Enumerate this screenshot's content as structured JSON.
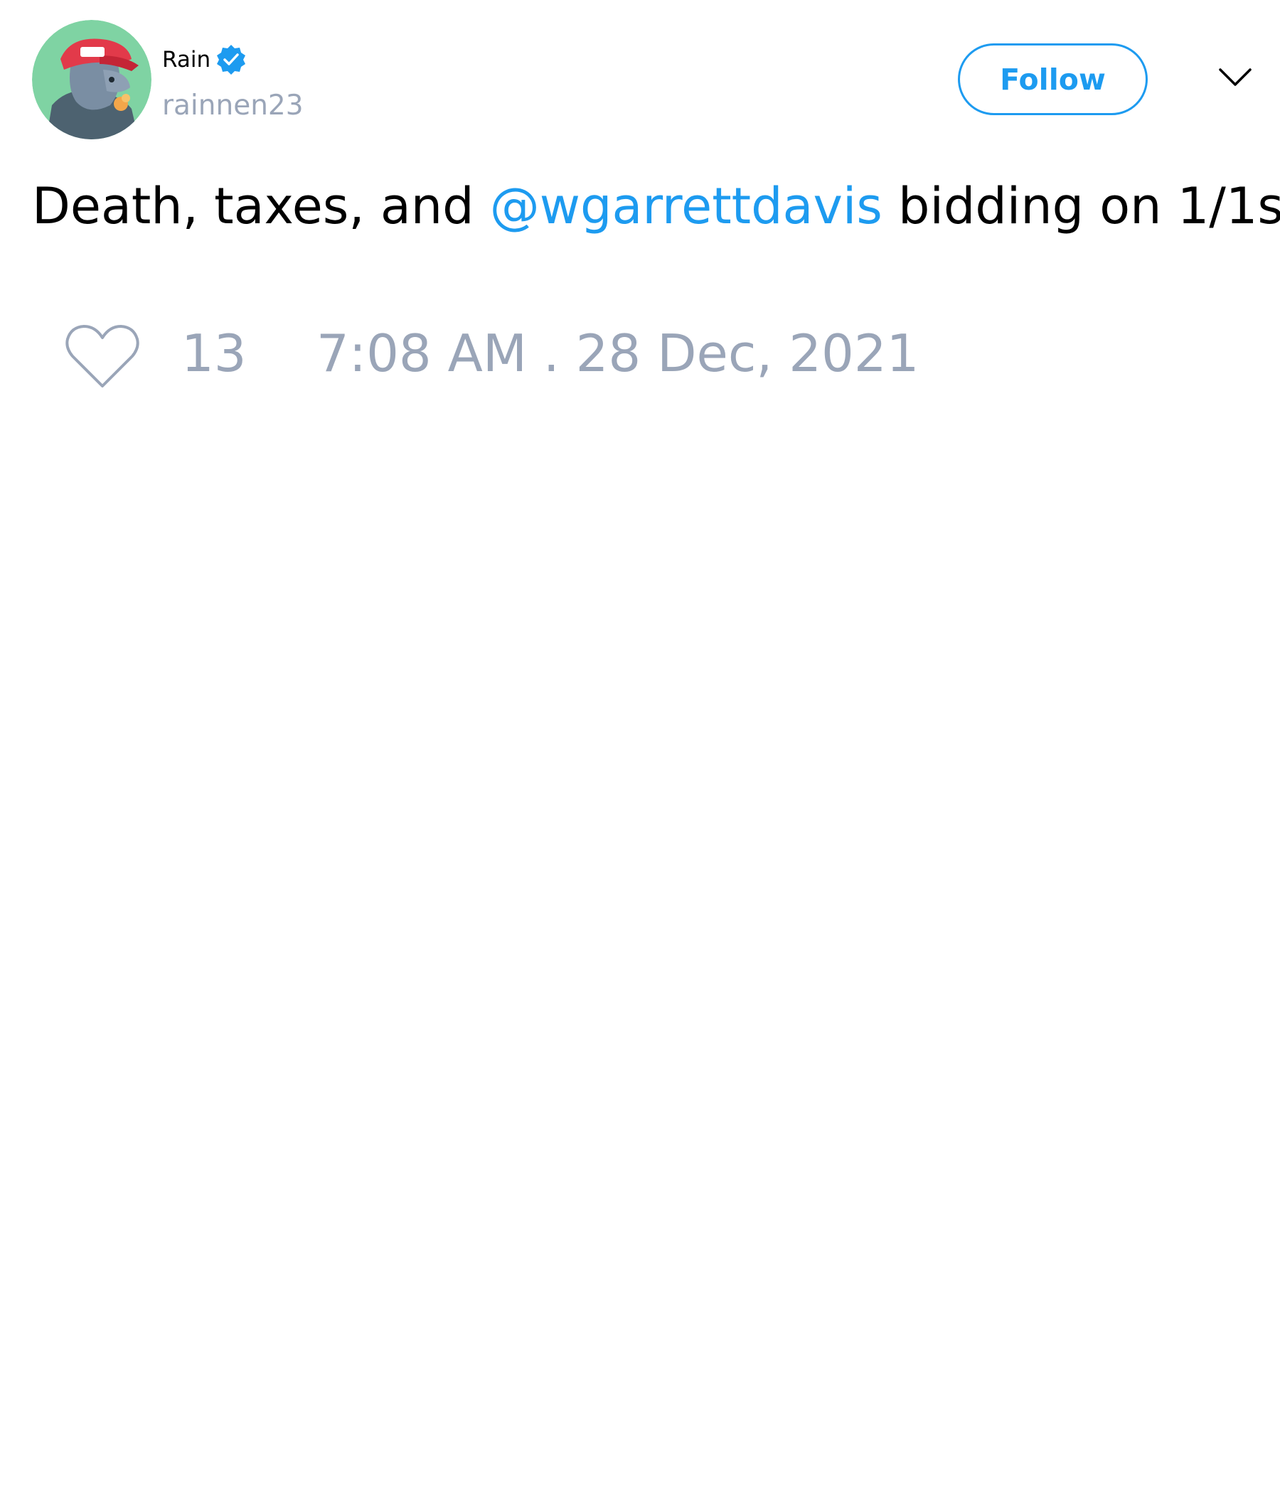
{
  "author": {
    "display_name": "Rain",
    "handle": "rainnen23",
    "verified": true,
    "avatar": "cartoon-character-with-red-cap"
  },
  "follow_button": {
    "label": "Follow"
  },
  "menu": {
    "icon": "chevron-down-icon"
  },
  "tweet": {
    "text_before": "Death, taxes, and ",
    "mention": "@wgarrettdavis",
    "text_after": " bidding on 1/1s"
  },
  "engagement": {
    "like_icon": "heart-outline-icon",
    "like_count": "13",
    "timestamp": "7:08 AM . 28 Dec, 2021"
  },
  "colors": {
    "accent": "#1d9bf0",
    "muted": "#9aa5b8",
    "text": "#000000",
    "avatar_bg": "#7fd3a3"
  }
}
